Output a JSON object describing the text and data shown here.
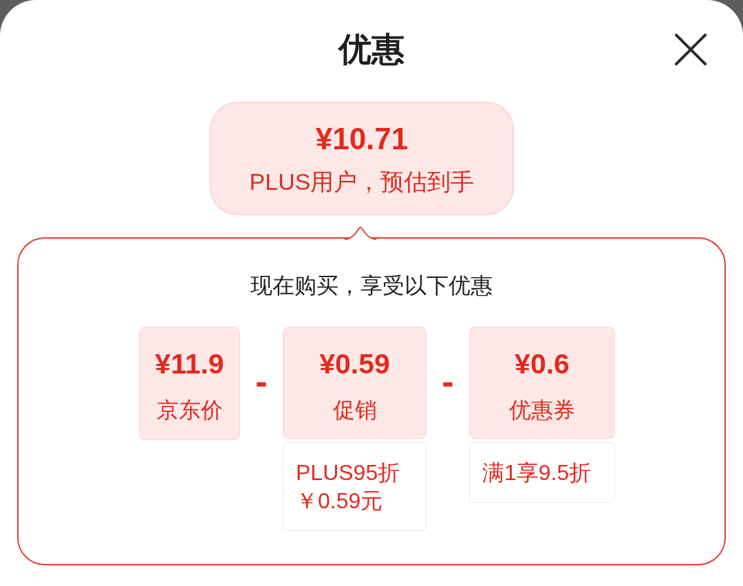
{
  "header": {
    "title": "优惠"
  },
  "estimate": {
    "amount": "¥10.71",
    "caption": "PLUS用户，预估到手"
  },
  "breakdown": {
    "heading": "现在购买，享受以下优惠",
    "items": [
      {
        "amount": "¥11.9",
        "label": "京东价"
      },
      {
        "operator": "-",
        "amount": "¥0.59",
        "label": "促销",
        "detail_lines": [
          "PLUS95折",
          "￥0.59元"
        ]
      },
      {
        "operator": "-",
        "amount": "¥0.6",
        "label": "优惠券",
        "detail_lines": [
          "满1享9.5折"
        ]
      }
    ]
  }
}
